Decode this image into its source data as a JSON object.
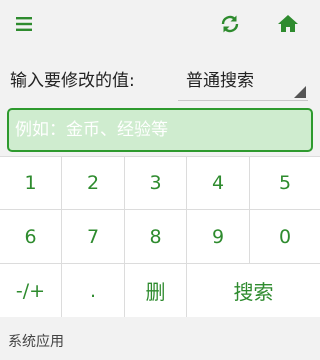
{
  "header": {
    "menu_icon": "menu-icon",
    "refresh_icon": "refresh-icon",
    "home_icon": "home-icon",
    "accent_color": "#2e8b2e"
  },
  "form": {
    "value_label": "输入要修改的值:",
    "search_type": "普通搜索",
    "input_placeholder": "例如：金币、经验等",
    "input_value": ""
  },
  "keypad": {
    "keys": [
      "1",
      "2",
      "3",
      "4",
      "5",
      "6",
      "7",
      "8",
      "9",
      "0",
      "-/+",
      ".",
      "删",
      "搜索"
    ]
  },
  "footer": {
    "label": "系统应用"
  }
}
